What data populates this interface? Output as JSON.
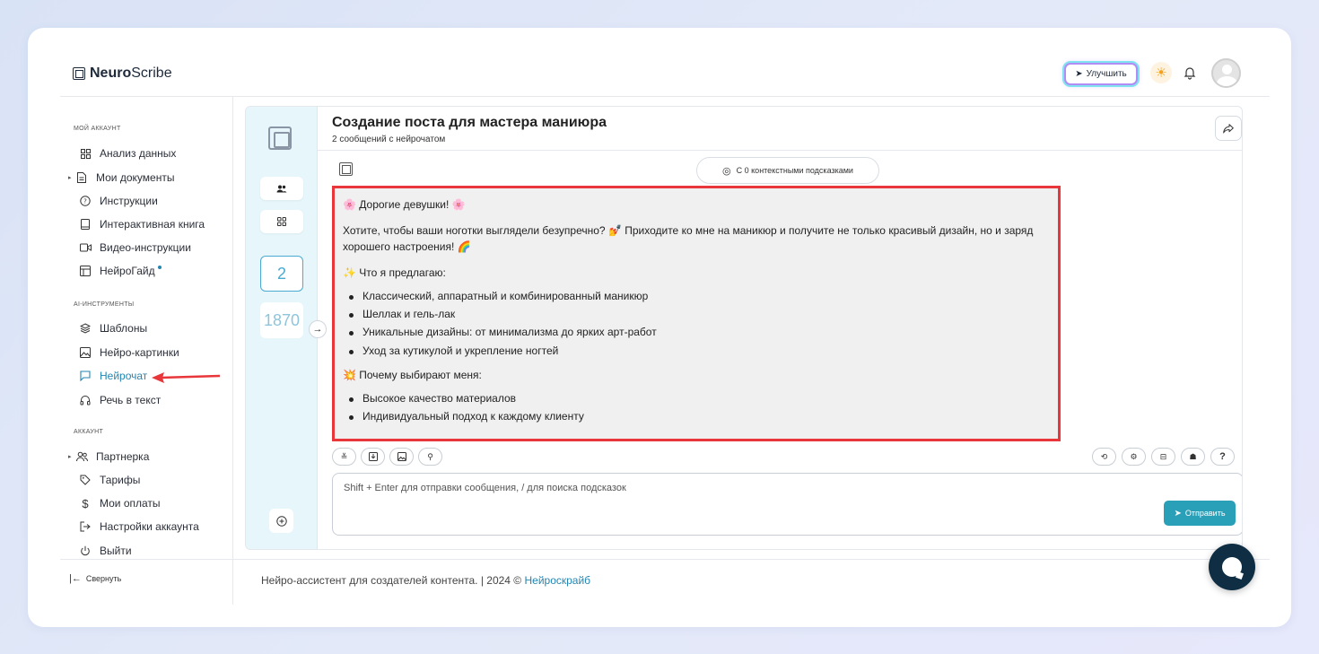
{
  "brand": {
    "name_bold": "Neuro",
    "name_light": "Scribe"
  },
  "header": {
    "upgrade_label": "Улучшить"
  },
  "sidebar": {
    "section_account": "МОЙ АККАУНТ",
    "account_items": [
      {
        "label": "Анализ данных",
        "icon": "grid-icon"
      },
      {
        "label": "Мои документы",
        "icon": "document-icon"
      },
      {
        "label": "Инструкции",
        "icon": "help-icon"
      },
      {
        "label": "Интерактивная книга",
        "icon": "book-icon"
      },
      {
        "label": "Видео-инструкции",
        "icon": "video-icon"
      },
      {
        "label": "НейроГайд",
        "icon": "guide-icon"
      }
    ],
    "section_ai": "AI-ИНСТРУМЕНТЫ",
    "ai_items": [
      {
        "label": "Шаблоны",
        "icon": "layers-icon"
      },
      {
        "label": "Нейро-картинки",
        "icon": "image-icon"
      },
      {
        "label": "Нейрочат",
        "icon": "chat-icon"
      },
      {
        "label": "Речь в текст",
        "icon": "headphones-icon"
      }
    ],
    "section_acc2": "АККАУНТ",
    "acc2_items": [
      {
        "label": "Партнерка",
        "icon": "users-icon"
      },
      {
        "label": "Тарифы",
        "icon": "tag-icon"
      },
      {
        "label": "Мои оплаты",
        "icon": "dollar-icon"
      },
      {
        "label": "Настройки аккаунта",
        "icon": "settings-icon"
      },
      {
        "label": "Выйти",
        "icon": "power-icon"
      }
    ],
    "collapse_label": "Свернуть"
  },
  "chat": {
    "title": "Создание поста для мастера маниюра",
    "subtitle": "2 сообщений с нейрочатом",
    "message_count": "2",
    "token_count": "1870",
    "hints_label": "С 0 контекстными подсказками",
    "message": {
      "greeting": "🌸 Дорогие девушки! 🌸",
      "intro": "Хотите, чтобы ваши ноготки выглядели безупречно? 💅 Приходите ко мне на маникюр и получите не только красивый дизайн, но и заряд хорошего настроения! 🌈",
      "offer_title": "✨ Что я предлагаю:",
      "offers": [
        "Классический, аппаратный и комбинированный маникюр",
        "Шеллак и гель-лак",
        "Уникальные дизайны: от минимализма до ярких арт-работ",
        "Уход за кутикулой и укрепление ногтей"
      ],
      "why_title": "💥 Почему выбирают меня:",
      "reasons": [
        "Высокое качество материалов",
        "Индивидуальный подход к каждому клиенту"
      ]
    },
    "input_placeholder": "Shift + Enter для отправки сообщения, / для поиска подсказок",
    "send_label": "Отправить",
    "help_label": "?"
  },
  "footer": {
    "text": "Нейро-ассистент для создателей контента.  | 2024 © ",
    "link": "Нейроскрайб"
  },
  "colors": {
    "accent": "#2585b0",
    "highlight": "#e8363b",
    "send": "#2a9fb8",
    "strip": "#e6f6fb"
  }
}
